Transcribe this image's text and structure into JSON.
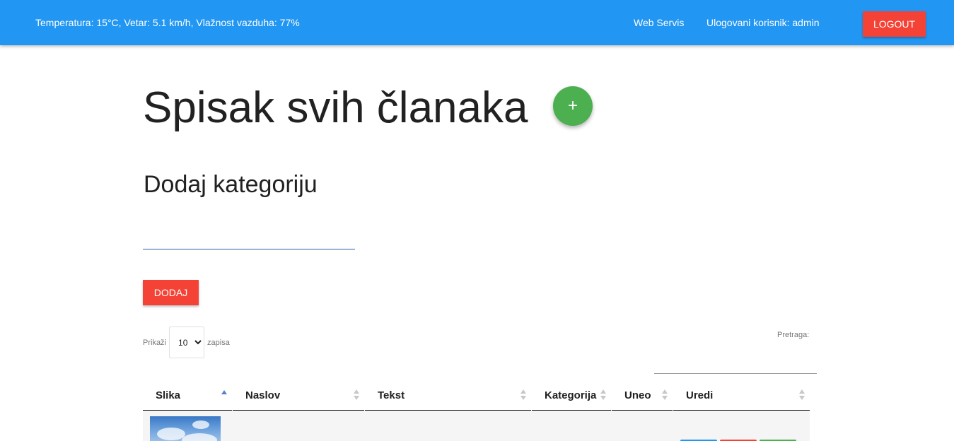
{
  "navbar": {
    "weather_text": "Temperatura: 15°C, Vetar: 5.1 km/h, Vlažnost vazduha: 77%",
    "web_servis_label": "Web Servis",
    "user_label": "Ulogovani korisnik: admin",
    "logout_label": "LOGOUT"
  },
  "page": {
    "title": "Spisak svih članaka",
    "add_icon": "plus-icon",
    "add_glyph": "+"
  },
  "category_form": {
    "title": "Dodaj kategoriju",
    "input_value": "",
    "submit_label": "DODAJ"
  },
  "table_controls": {
    "show_label": "Prikaži",
    "page_length": "10",
    "page_length_options": [
      "10"
    ],
    "records_label": "zapisa",
    "search_label": "Pretraga:"
  },
  "table": {
    "columns": [
      {
        "label": "Slika",
        "sort": "ascending"
      },
      {
        "label": "Naslov",
        "sort": "none"
      },
      {
        "label": "Tekst",
        "sort": "none"
      },
      {
        "label": "Kategorija",
        "sort": "none"
      },
      {
        "label": "Uneo",
        "sort": "none"
      },
      {
        "label": "Uredi",
        "sort": "none"
      }
    ]
  },
  "colors": {
    "navbar": "#2196f3",
    "logout": "#f44336",
    "fab": "#4caf50",
    "edit_action": "#2196f3",
    "delete_action": "#f44336",
    "view_action": "#4caf50"
  }
}
